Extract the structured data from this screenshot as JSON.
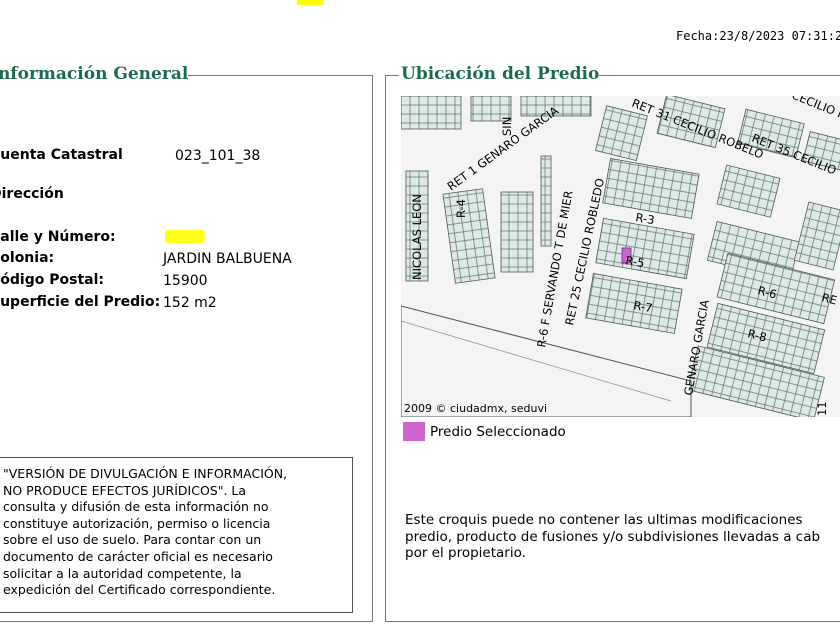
{
  "header": {
    "fecha": "Fecha:23/8/2023 07:31:2"
  },
  "info_general": {
    "legend": "Información General",
    "fields": [
      {
        "label": "Cuenta Catastral",
        "value": "023_101_38"
      },
      {
        "label": "Dirección"
      },
      {
        "label": "Calle y Número:",
        "value": ""
      },
      {
        "label": "Colonia:",
        "value": "JARDIN BALBUENA"
      },
      {
        "label": "Código Postal:",
        "value": "15900"
      },
      {
        "label": "Superficie del Predio:",
        "value": "152 m2"
      }
    ],
    "notice_lines": [
      "\"VERSIÓN DE DIVULGACIÓN E INFORMACIÓN,",
      "NO PRODUCE EFECTOS JURÍDICOS\". La",
      "consulta y difusión de esta información no",
      "constituye autorización, permiso o licencia",
      "sobre el uso de suelo. Para contar con un",
      "documento de carácter oficial es necesario",
      "solicitar a la autoridad competente, la",
      "expedición del Certificado correspondiente."
    ]
  },
  "ubicacion": {
    "legend": "Ubicación del Predio",
    "map": {
      "copyright": "2009 © ciudadmx, seduvi",
      "selected_color": "#cc66cc",
      "street_labels": [
        "RET 31 CECILIO ROBELO",
        "RET 35 CECILIO",
        "CECILIO R",
        "RET 1 GENARO GARCIA",
        "SIN",
        "NICOLAS LEON",
        "R-6 F SERVANDO T DE MIER",
        "RET 25 CECILIO ROBLEDO",
        "GENARO GARCIA",
        "11"
      ],
      "block_labels": [
        "R-4",
        "R-3",
        "R-5",
        "R-7",
        "R-6",
        "R-8",
        "RE"
      ]
    },
    "legend_label": "Predio Seleccionado",
    "disclaimer_lines": [
      "Este croquis puede no contener las ultimas modificaciones",
      "predio, producto de fusiones y/o subdivisiones llevadas a cab",
      "por el propietario."
    ]
  }
}
